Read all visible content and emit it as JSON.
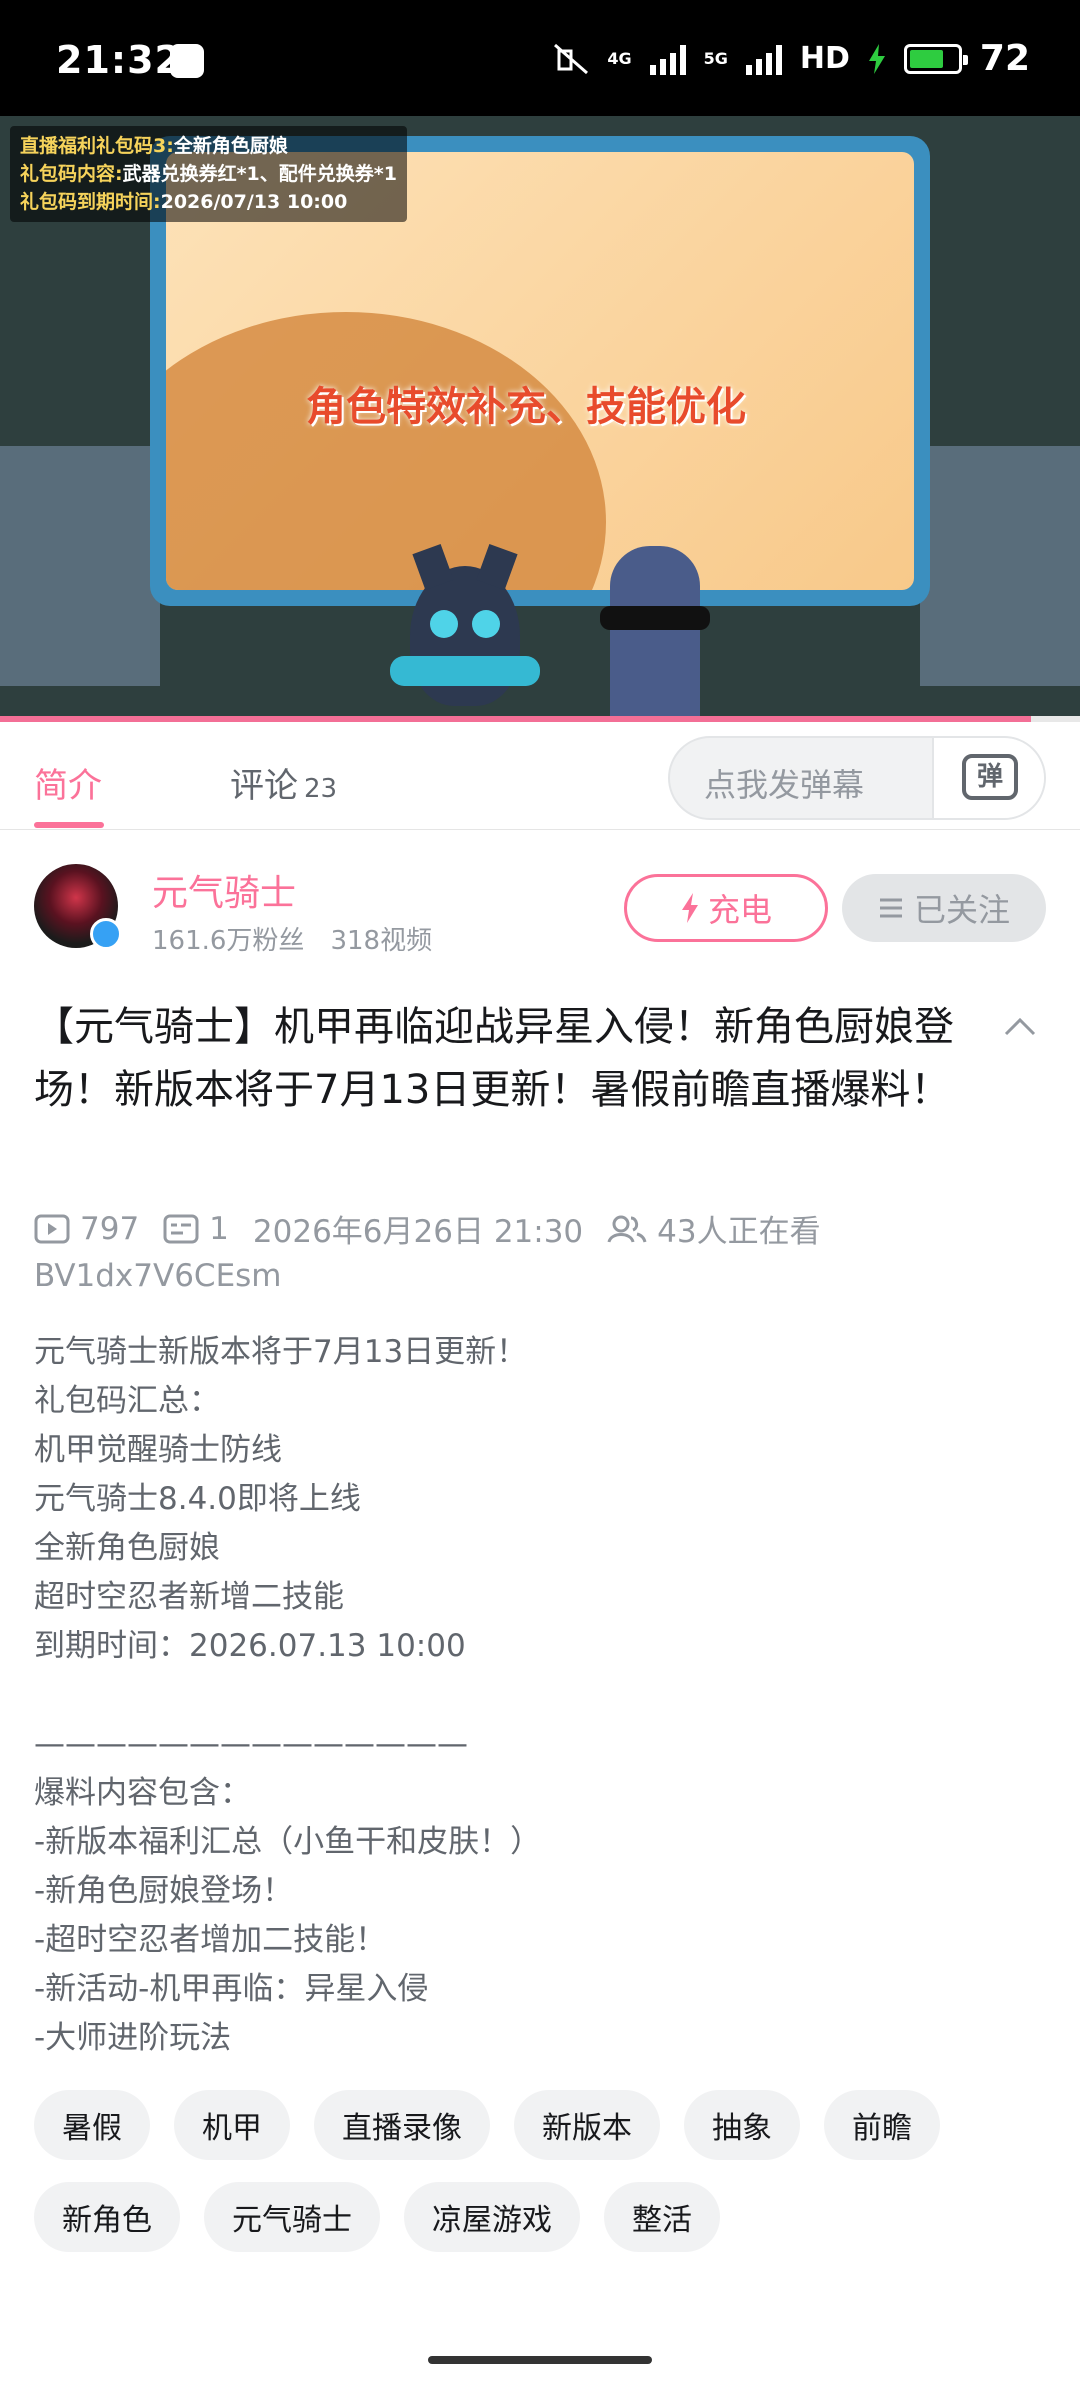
{
  "status_bar": {
    "time": "21:32",
    "network_1": "4G",
    "network_2": "5G",
    "hd": "HD",
    "battery": "72",
    "battery_level": 0.72
  },
  "video": {
    "overlay_lines": [
      {
        "k": "直播福利礼包码3:",
        "v": "全新角色厨娘"
      },
      {
        "k": "礼包码内容:",
        "v": "武器兑换券红*1、配件兑换券*1"
      },
      {
        "k": "礼包码到期时间:",
        "v": "2026/07/13 10:00"
      }
    ],
    "slogan": "角色特效补充、技能优化",
    "progress": 0.955
  },
  "tabs": {
    "intro": "简介",
    "comments": "评论",
    "comment_count": "23",
    "danmaku_placeholder": "点我发弹幕",
    "danmaku_icon_char": "弹"
  },
  "uploader": {
    "name": "元气骑士",
    "fans": "161.6万粉丝",
    "videos": "318视频",
    "charge_label": "充电",
    "follow_label": "已关注"
  },
  "video_title": "【元气骑士】机甲再临迎战异星入侵！新角色厨娘登场！新版本将于7月13日更新！暑假前瞻直播爆料！",
  "stats": {
    "plays": "797",
    "danmaku": "1",
    "date": "2026年6月26日 21:30",
    "watching": "43人正在看",
    "bvid": "BV1dx7V6CEsm"
  },
  "description": [
    "元气骑士新版本将于7月13日更新！",
    "礼包码汇总：",
    "机甲觉醒骑士防线",
    "元气骑士8.4.0即将上线",
    "全新角色厨娘",
    "超时空忍者新增二技能",
    "到期时间：2026.07.13 10:00",
    "",
    "——————————————",
    "爆料内容包含：",
    "-新版本福利汇总（小鱼干和皮肤！）",
    "-新角色厨娘登场！",
    "-超时空忍者增加二技能！",
    "-新活动-机甲再临：异星入侵",
    "-大师进阶玩法"
  ],
  "tags_row1": [
    "暑假",
    "机甲",
    "直播录像",
    "新版本",
    "抽象",
    "前瞻"
  ],
  "tags_row2": [
    "新角色",
    "元气骑士",
    "凉屋游戏",
    "整活"
  ]
}
